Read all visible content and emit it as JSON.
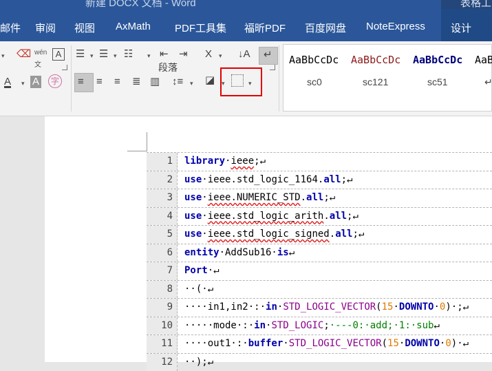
{
  "window": {
    "title": "新建 DOCX 文档 - Word",
    "context_tab_header": "表格工"
  },
  "ribbon_tabs": [
    "邮件",
    "审阅",
    "视图",
    "AxMath",
    "PDF工具集",
    "福昕PDF",
    "百度网盘",
    "NoteExpress",
    "设计"
  ],
  "paragraph_group": {
    "label": "段落",
    "highlighted_control": "borders-button",
    "active_alignment": "align-left"
  },
  "styles": [
    {
      "sample": "AaBbCcDc",
      "name": "sc0",
      "color": "#000000"
    },
    {
      "sample": "AaBbCcDc",
      "name": "sc121",
      "color": "#8b1a1a"
    },
    {
      "sample": "AaBbCcDc",
      "name": "sc51",
      "color": "#00007a"
    },
    {
      "sample": "AaBb",
      "name": "↵",
      "color": "#000000"
    }
  ],
  "code_lines": [
    {
      "n": "1",
      "html": "<span class=\"kw\">library</span>·<span class=\"sq\">ieee</span>;↵"
    },
    {
      "n": "2",
      "html": "<span class=\"kw\">use</span>·ieee.std_logic_1164.<span class=\"kw\">all</span>;↵"
    },
    {
      "n": "3",
      "html": "<span class=\"kw\">use</span>·<span class=\"sq\">ieee.NUMERIC_STD</span>.<span class=\"kw\">all</span>;↵"
    },
    {
      "n": "4",
      "html": "<span class=\"kw\">use</span>·<span class=\"sq\">ieee.std_logic_arith</span>.<span class=\"kw\">all</span>;↵"
    },
    {
      "n": "5",
      "html": "<span class=\"kw\">use</span>·<span class=\"sq\">ieee.std_logic_signed</span>.<span class=\"kw\">all</span>;↵"
    },
    {
      "n": "6",
      "html": "<span class=\"kw\">entity</span>·AddSub16·<span class=\"kw\">is</span>↵"
    },
    {
      "n": "7",
      "html": "<span class=\"kw\">Port</span>·↵"
    },
    {
      "n": "8",
      "html": "··(·↵"
    },
    {
      "n": "9",
      "html": "····in1,in2·:·<span class=\"kw\">in</span>·<span class=\"typ\">STD_LOGIC_VECTOR</span>(<span class=\"num\">15</span>·<span class=\"kw\">DOWNTO</span>·<span class=\"num\">0</span>)·;↵"
    },
    {
      "n": "10",
      "html": "·····mode·:·<span class=\"kw\">in</span>·<span class=\"typ\">STD_LOGIC</span>;<span class=\"cmt\">·---0:·add;·1:·sub</span>↵"
    },
    {
      "n": "11",
      "html": "····out1·:·<span class=\"kw\">buffer</span>·<span class=\"typ\">STD_LOGIC_VECTOR</span>(<span class=\"num\">15</span>·<span class=\"kw\">DOWNTO</span>·<span class=\"num\">0</span>)·↵"
    },
    {
      "n": "12",
      "html": "··);↵"
    }
  ]
}
